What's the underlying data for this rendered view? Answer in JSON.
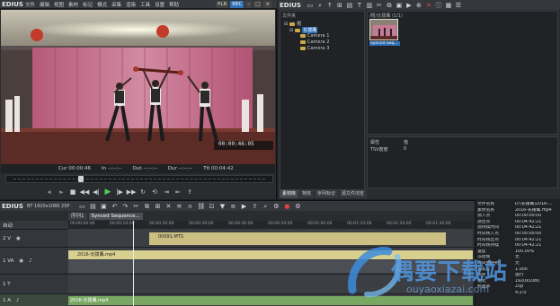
{
  "player": {
    "app_name": "EDIUS",
    "menus": [
      "文件",
      "编辑",
      "视图",
      "素材",
      "标记",
      "模式",
      "采集",
      "渲染",
      "工具",
      "设置",
      "帮助"
    ],
    "mode_tabs": [
      "PLR",
      "REC"
    ],
    "active_mode": "REC",
    "overlay_timecode": "00:00:46:05",
    "cur_label": "Cur",
    "cur_value": "00:00:46",
    "in_label": "In",
    "in_value": "--:--:--",
    "out_label": "Out",
    "out_value": "--:--:--",
    "dur_label": "Dur",
    "dur_value": "--:--:--",
    "ttl_label": "Ttl",
    "ttl_value": "00:04:42"
  },
  "bin": {
    "app_name": "EDIUS",
    "folder_header": "文件夹",
    "tree": {
      "root": "根",
      "selected": "长拨鹰",
      "children": [
        "Camera 1",
        "Camera 2",
        "Camera 3"
      ]
    },
    "clip_header": "/根/长拨鹰 (1/1)",
    "clip_name": "Synced Seq...",
    "properties": {
      "col_prop": "属性",
      "col_val": "值",
      "row_key": "TSV度度",
      "row_val": "0"
    },
    "tabs": [
      "素材库",
      "特效",
      "序列标记",
      "源文件浏览"
    ],
    "active_tab": "素材库"
  },
  "timeline": {
    "app_name": "EDIUS",
    "format": "BT 1920x1080 25P",
    "sequence_tabs": [
      "序列1",
      "Synced Sequence..."
    ],
    "active_sequence": "Synced Sequence...",
    "ruler_ticks": [
      "00:00:00:00",
      "00:00:10:00",
      "00:00:20:00",
      "00:00:30:00",
      "00:00:40:00",
      "00:00:50:00",
      "00:01:00:00",
      "00:01:10:00",
      "00:01:20:00",
      "00:01:30:00",
      "00:01:40:00"
    ],
    "header_mode": "自动",
    "tracks": [
      {
        "name": "2 V",
        "clip": "00091.MTS",
        "style": "yellow"
      },
      {
        "name": "1 VA",
        "clip": "2016-长拨鹰.mp4",
        "style": "yellow2"
      },
      {
        "name": "1 T",
        "clip": "",
        "style": "empty"
      },
      {
        "name": "1 A",
        "clip": "2016-长拨鹰.mp4",
        "style": "green"
      }
    ]
  },
  "info_panel": {
    "rows": [
      {
        "k": "文件名称",
        "v": "D:\\长拨鹰\\2016-..."
      },
      {
        "k": "素材名称",
        "v": "2016-长拨鹰.mp4"
      },
      {
        "k": "源入点",
        "v": "00:00:00:00"
      },
      {
        "k": "源出点",
        "v": "00:04:42:21"
      },
      {
        "k": "源持续时间",
        "v": "00:04:42:21"
      },
      {
        "k": "时间线入点",
        "v": "00:00:00:00"
      },
      {
        "k": "时间线出点",
        "v": "00:04:42:21"
      },
      {
        "k": "时间线持续",
        "v": "00:04:42:21"
      },
      {
        "k": "速度",
        "v": "100.00%"
      },
      {
        "k": "冻结帧",
        "v": "无"
      },
      {
        "k": "时间重映射",
        "v": "无"
      },
      {
        "k": "宽高比",
        "v": "1.000"
      },
      {
        "k": "场序",
        "v": "逐行"
      },
      {
        "k": "格式",
        "v": "1920x1080"
      },
      {
        "k": "帧速率",
        "v": "25p"
      },
      {
        "k": "",
        "v": "4:2:0"
      }
    ]
  },
  "watermark": {
    "brand": "偶要下载站",
    "url": "ouyaoxiazai.com"
  },
  "colors": {
    "accent_blue": "#2f6fb5",
    "play_green": "#4cd05a",
    "clip_yellow": "#cbc081",
    "clip_green": "#78a862",
    "icon_red": "#e04545"
  }
}
